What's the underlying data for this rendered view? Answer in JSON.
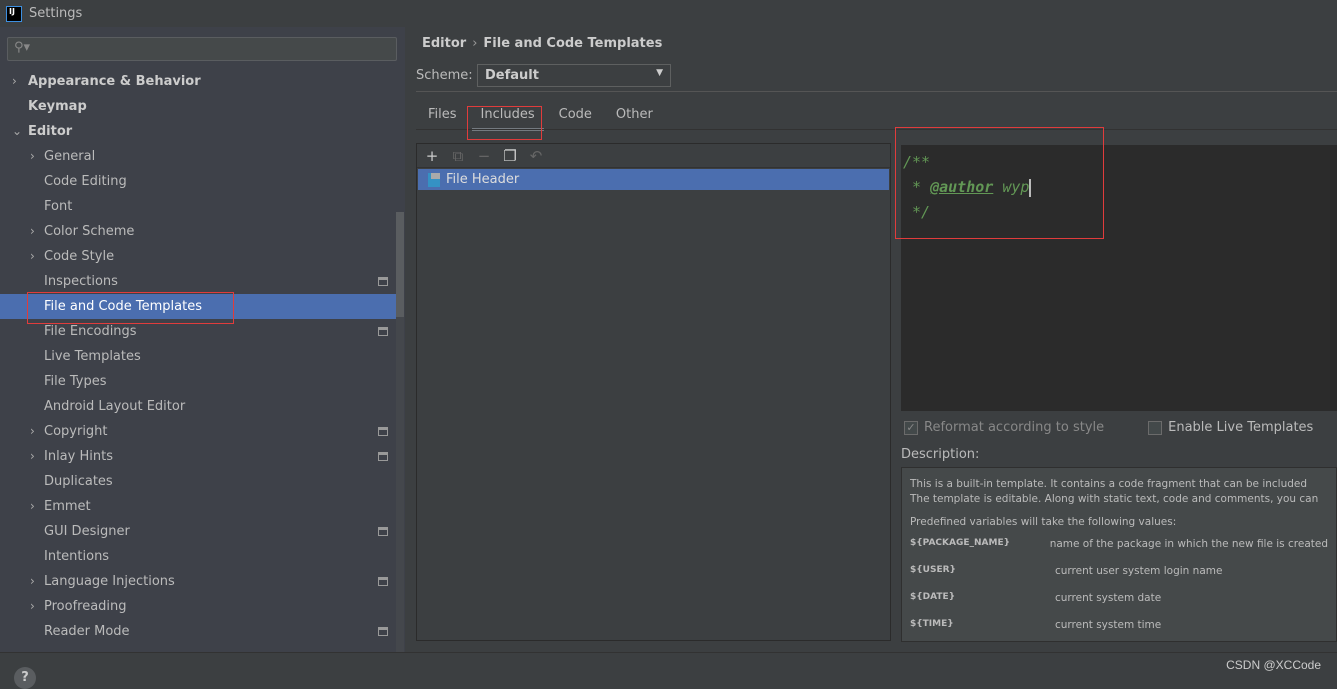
{
  "window": {
    "title": "Settings",
    "logo": "IJ"
  },
  "search": {
    "placeholder": "",
    "icon": "search-icon"
  },
  "tree": [
    {
      "label": "Appearance & Behavior",
      "level": 0,
      "arrow": "›",
      "bold": true
    },
    {
      "label": "Keymap",
      "level": 0,
      "arrow": "",
      "bold": true
    },
    {
      "label": "Editor",
      "level": 0,
      "arrow": "⌄",
      "bold": true
    },
    {
      "label": "General",
      "level": 1,
      "arrow": "›"
    },
    {
      "label": "Code Editing",
      "level": 1,
      "arrow": ""
    },
    {
      "label": "Font",
      "level": 1,
      "arrow": ""
    },
    {
      "label": "Color Scheme",
      "level": 1,
      "arrow": "›"
    },
    {
      "label": "Code Style",
      "level": 1,
      "arrow": "›"
    },
    {
      "label": "Inspections",
      "level": 1,
      "arrow": "",
      "proj": true
    },
    {
      "label": "File and Code Templates",
      "level": 1,
      "arrow": "",
      "selected": true
    },
    {
      "label": "File Encodings",
      "level": 1,
      "arrow": "",
      "proj": true
    },
    {
      "label": "Live Templates",
      "level": 1,
      "arrow": ""
    },
    {
      "label": "File Types",
      "level": 1,
      "arrow": ""
    },
    {
      "label": "Android Layout Editor",
      "level": 1,
      "arrow": ""
    },
    {
      "label": "Copyright",
      "level": 1,
      "arrow": "›",
      "proj": true
    },
    {
      "label": "Inlay Hints",
      "level": 1,
      "arrow": "›",
      "proj": true
    },
    {
      "label": "Duplicates",
      "level": 1,
      "arrow": ""
    },
    {
      "label": "Emmet",
      "level": 1,
      "arrow": "›"
    },
    {
      "label": "GUI Designer",
      "level": 1,
      "arrow": "",
      "proj": true
    },
    {
      "label": "Intentions",
      "level": 1,
      "arrow": ""
    },
    {
      "label": "Language Injections",
      "level": 1,
      "arrow": "›",
      "proj": true
    },
    {
      "label": "Proofreading",
      "level": 1,
      "arrow": "›"
    },
    {
      "label": "Reader Mode",
      "level": 1,
      "arrow": "",
      "proj": true
    }
  ],
  "breadcrumb": {
    "parent": "Editor",
    "sep": "›",
    "current": "File and Code Templates"
  },
  "scheme": {
    "label": "Scheme:",
    "value": "Default"
  },
  "tabs": [
    {
      "label": "Files"
    },
    {
      "label": "Includes",
      "active": true
    },
    {
      "label": "Code"
    },
    {
      "label": "Other"
    }
  ],
  "toolbar": {
    "add": "+",
    "copy_icon": "⧉",
    "remove": "−",
    "duplicate": "❐",
    "reset": "↶"
  },
  "templates": [
    {
      "name": "File Header",
      "selected": true
    }
  ],
  "editor": {
    "line1": "/**",
    "line2_prefix": " * ",
    "line2_tag": "@author",
    "line2_value": " wyp",
    "line3": " */"
  },
  "options": {
    "reformat": {
      "label": "Reformat according to style",
      "checked": true,
      "enabled": false
    },
    "live": {
      "label": "Enable Live Templates",
      "checked": false
    }
  },
  "description": {
    "label": "Description:",
    "line1": "This is a built-in template. It contains a code fragment that can be included",
    "line2": "The template is editable. Along with static text, code and comments, you can",
    "line3": "Predefined variables will take the following values:",
    "vars": [
      {
        "name": "${PACKAGE_NAME}",
        "desc": "name of the package in which the new file is created"
      },
      {
        "name": "${USER}",
        "desc": "current user system login name"
      },
      {
        "name": "${DATE}",
        "desc": "current system date"
      },
      {
        "name": "${TIME}",
        "desc": "current system time"
      }
    ]
  },
  "footer": {
    "help": "?",
    "watermark": "CSDN @XCCode"
  },
  "colors": {
    "selection": "#4b6eaf",
    "highlight_box": "#e03c3c",
    "comment": "#629755"
  }
}
